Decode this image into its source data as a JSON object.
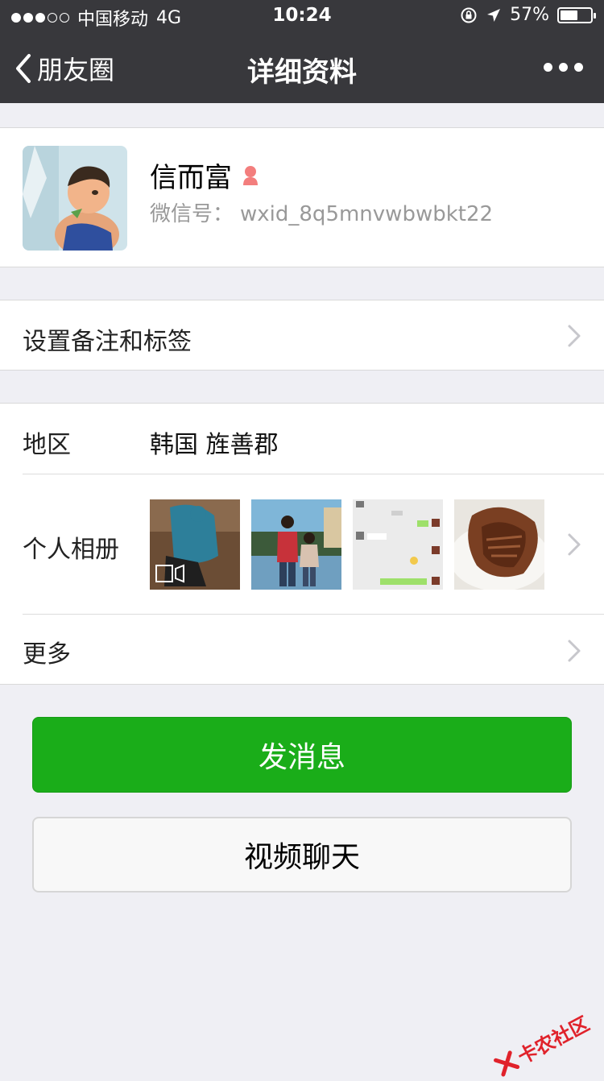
{
  "status_bar": {
    "carrier": "中国移动",
    "network": "4G",
    "time": "10:24",
    "battery": "57%",
    "battery_level": 0.57
  },
  "nav": {
    "back_label": "朋友圈",
    "title": "详细资料"
  },
  "profile": {
    "name": "信而富",
    "wechat_id_label": "微信号：",
    "wechat_id": "wxid_8q5mnvwbwbkt22",
    "gender": "female"
  },
  "remark_row": {
    "label": "设置备注和标签"
  },
  "region": {
    "label": "地区",
    "value": "韩国 旌善郡"
  },
  "album": {
    "label": "个人相册"
  },
  "more_row": {
    "label": "更多"
  },
  "actions": {
    "send_message": "发消息",
    "video_chat": "视频聊天"
  },
  "watermark": {
    "text": "卡农社区"
  },
  "colors": {
    "header_bg": "#38383c",
    "primary_green": "#1aad19",
    "page_bg": "#efeff4"
  }
}
